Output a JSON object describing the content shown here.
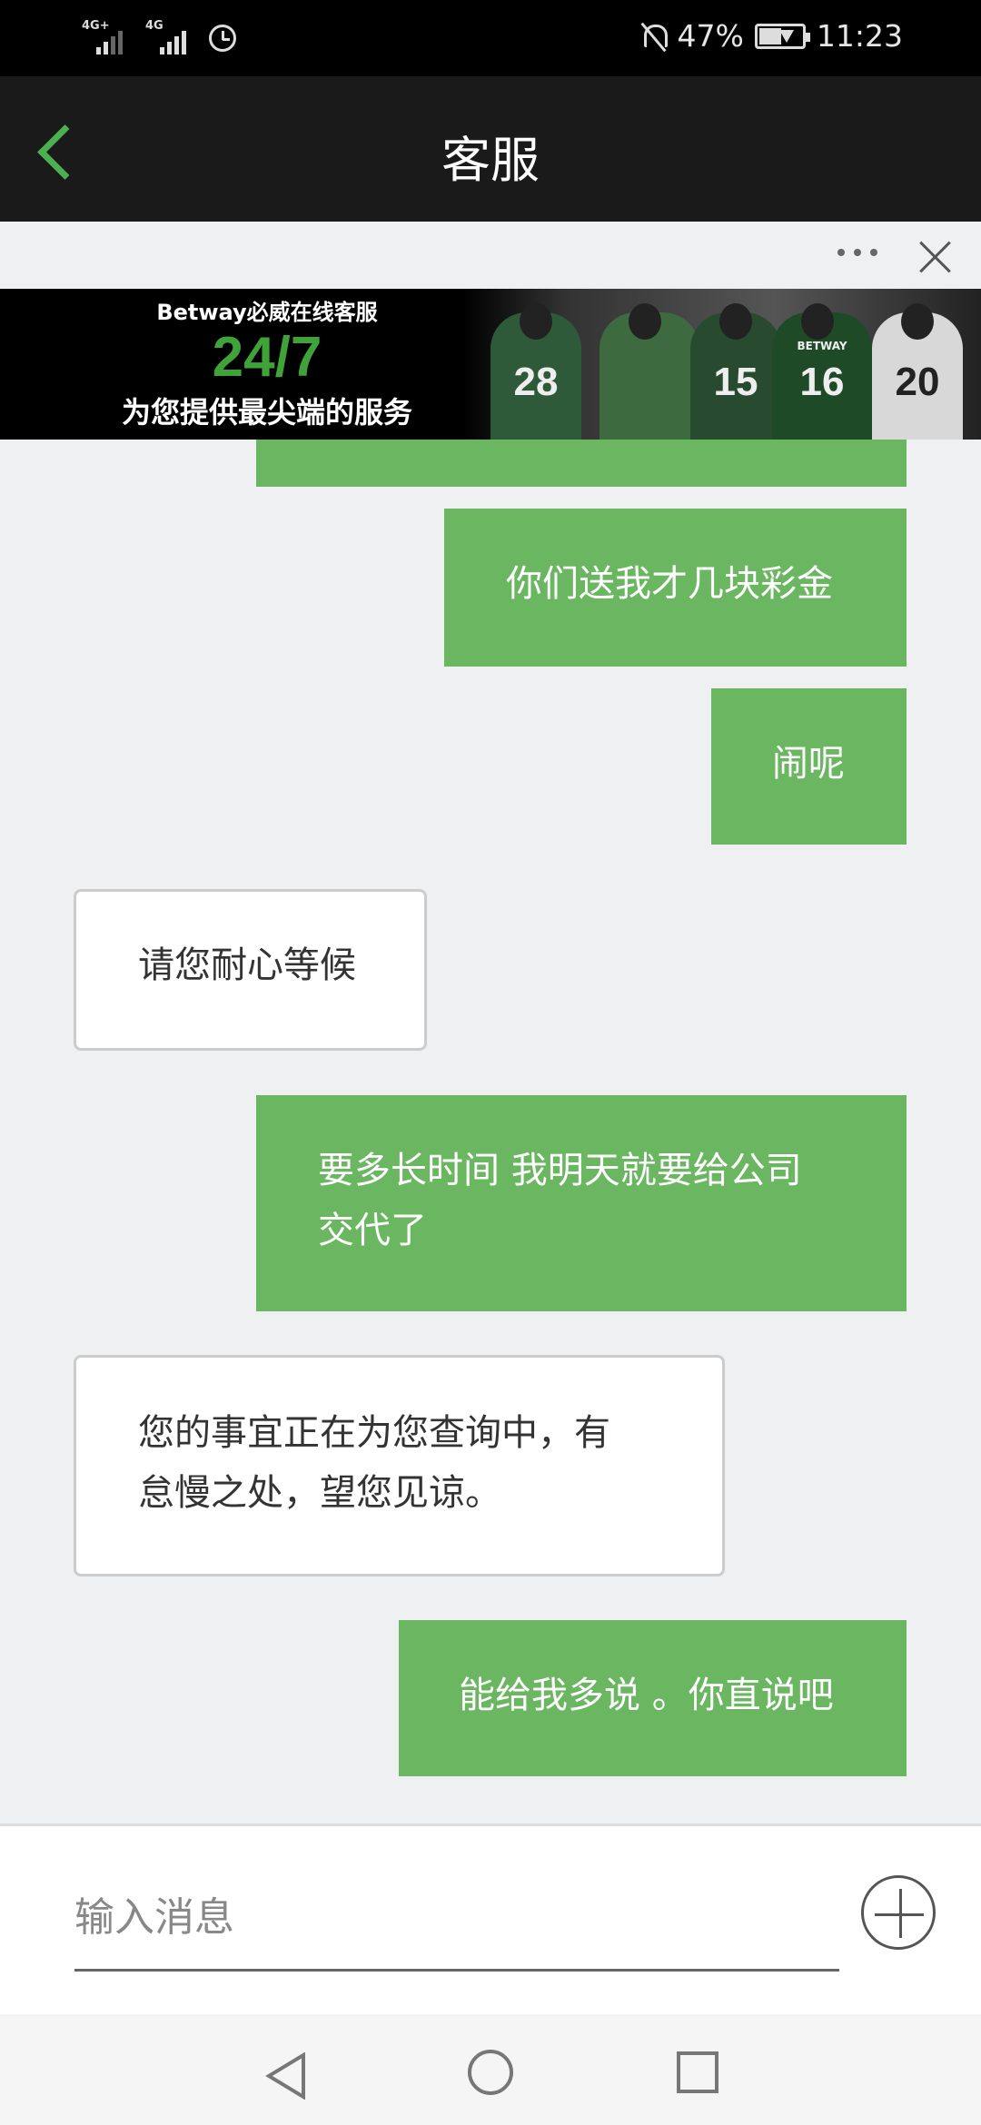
{
  "status_bar": {
    "signal1_tag": "4G+",
    "signal2_tag": "4G",
    "battery_percent": "47%",
    "time": "11:23"
  },
  "header": {
    "title": "客服"
  },
  "banner": {
    "brand_line": "Betway必威在线客服",
    "headline": "24/7",
    "subline": "为您提供最尖端的服务",
    "jersey_numbers": [
      "28",
      "15",
      "16",
      "20"
    ],
    "jersey_brand": "BETWAY"
  },
  "messages": [
    {
      "sender": "me",
      "text": ""
    },
    {
      "sender": "me",
      "text": "你们送我才几块彩金"
    },
    {
      "sender": "me",
      "text": "闹呢"
    },
    {
      "sender": "agent",
      "text": "请您耐心等候"
    },
    {
      "sender": "me",
      "lines": [
        "要多长时间 我明天就要给公司",
        "交代了"
      ]
    },
    {
      "sender": "agent",
      "lines": [
        "您的事宜正在为您查询中，有",
        "怠慢之处，望您见谅。"
      ]
    },
    {
      "sender": "me",
      "text": "能给我多说 。你直说吧"
    }
  ],
  "composer": {
    "placeholder": "输入消息"
  },
  "colors": {
    "accent_green": "#4caf50",
    "bubble_me": "#6bb661",
    "banner_green": "#3fa33a"
  }
}
